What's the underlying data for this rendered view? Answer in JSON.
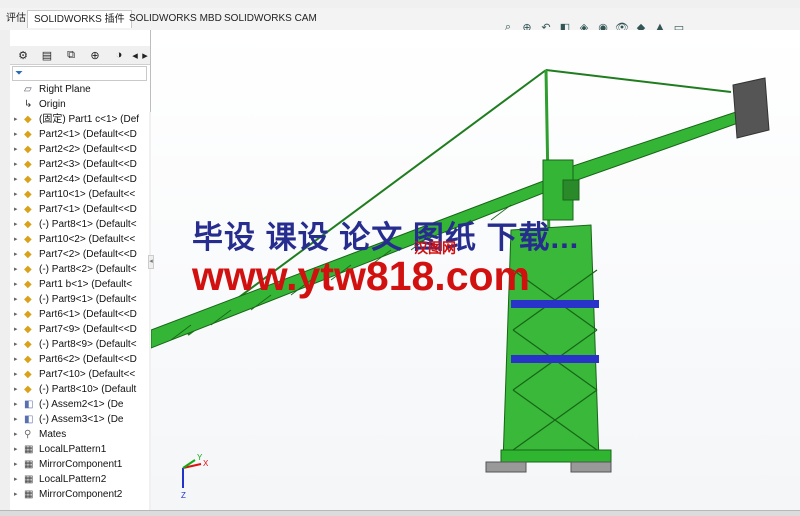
{
  "tabs": [
    "评估",
    "SOLIDWORKS 插件",
    "SOLIDWORKS MBD",
    "SOLIDWORKS CAM"
  ],
  "active_tab": 1,
  "headsup_icons": [
    "zoom-to-fit-icon",
    "zoom-area-icon",
    "previous-view-icon",
    "section-view-icon",
    "view-orientation-icon",
    "display-style-icon",
    "hide-show-icon",
    "appearance-icon",
    "scene-icon",
    "display-settings-icon"
  ],
  "panel": {
    "tabs": [
      "feature-manager-icon",
      "property-manager-icon",
      "configuration-manager-icon",
      "dimxpert-icon",
      "display-manager-icon"
    ],
    "filter_icon": "filter-icon"
  },
  "tree_items": [
    {
      "label": "Right Plane",
      "icon": "plane",
      "arrow": false
    },
    {
      "label": "Origin",
      "icon": "origin",
      "arrow": false
    },
    {
      "label": "(固定) Part1 c<1> (Def",
      "icon": "part",
      "arrow": true
    },
    {
      "label": "Part2<1> (Default<<D",
      "icon": "part",
      "arrow": true
    },
    {
      "label": "Part2<2> (Default<<D",
      "icon": "part",
      "arrow": true
    },
    {
      "label": "Part2<3> (Default<<D",
      "icon": "part",
      "arrow": true
    },
    {
      "label": "Part2<4> (Default<<D",
      "icon": "part",
      "arrow": true
    },
    {
      "label": "Part10<1> (Default<<",
      "icon": "part",
      "arrow": true
    },
    {
      "label": "Part7<1> (Default<<D",
      "icon": "part",
      "arrow": true
    },
    {
      "label": "(-) Part8<1> (Default<",
      "icon": "part",
      "arrow": true
    },
    {
      "label": "Part10<2> (Default<<",
      "icon": "part",
      "arrow": true
    },
    {
      "label": "Part7<2> (Default<<D",
      "icon": "part",
      "arrow": true
    },
    {
      "label": "(-) Part8<2> (Default<",
      "icon": "part",
      "arrow": true
    },
    {
      "label": "Part1 b<1> (Default<",
      "icon": "part",
      "arrow": true
    },
    {
      "label": "(-) Part9<1> (Default<",
      "icon": "part",
      "arrow": true
    },
    {
      "label": "Part6<1> (Default<<D",
      "icon": "part",
      "arrow": true
    },
    {
      "label": "Part7<9> (Default<<D",
      "icon": "part",
      "arrow": true
    },
    {
      "label": "(-) Part8<9> (Default<",
      "icon": "part",
      "arrow": true
    },
    {
      "label": "Part6<2> (Default<<D",
      "icon": "part",
      "arrow": true
    },
    {
      "label": "Part7<10> (Default<<",
      "icon": "part",
      "arrow": true
    },
    {
      "label": "(-) Part8<10> (Default",
      "icon": "part",
      "arrow": true
    },
    {
      "label": "(-) Assem2<1> (De",
      "icon": "assembly",
      "arrow": true
    },
    {
      "label": "(-) Assem3<1> (De",
      "icon": "assembly",
      "arrow": true
    },
    {
      "label": "Mates",
      "icon": "mates",
      "arrow": true
    },
    {
      "label": "LocalLPattern1",
      "icon": "pattern",
      "arrow": true
    },
    {
      "label": "MirrorComponent1",
      "icon": "pattern",
      "arrow": true
    },
    {
      "label": "LocalLPattern2",
      "icon": "pattern",
      "arrow": true
    },
    {
      "label": "MirrorComponent2",
      "icon": "pattern",
      "arrow": true
    }
  ],
  "watermark": {
    "line1": "毕设 课设 论文 图纸 下载...",
    "line2": "www.ytw818.com",
    "small": "汉图网"
  },
  "triad": {
    "x": "X",
    "y": "Y",
    "z": "Z"
  },
  "colors": {
    "crane": "#2fb52f",
    "crane_dark": "#1a6b1a",
    "blue": "#2a33c9",
    "counterweight": "#555555"
  }
}
